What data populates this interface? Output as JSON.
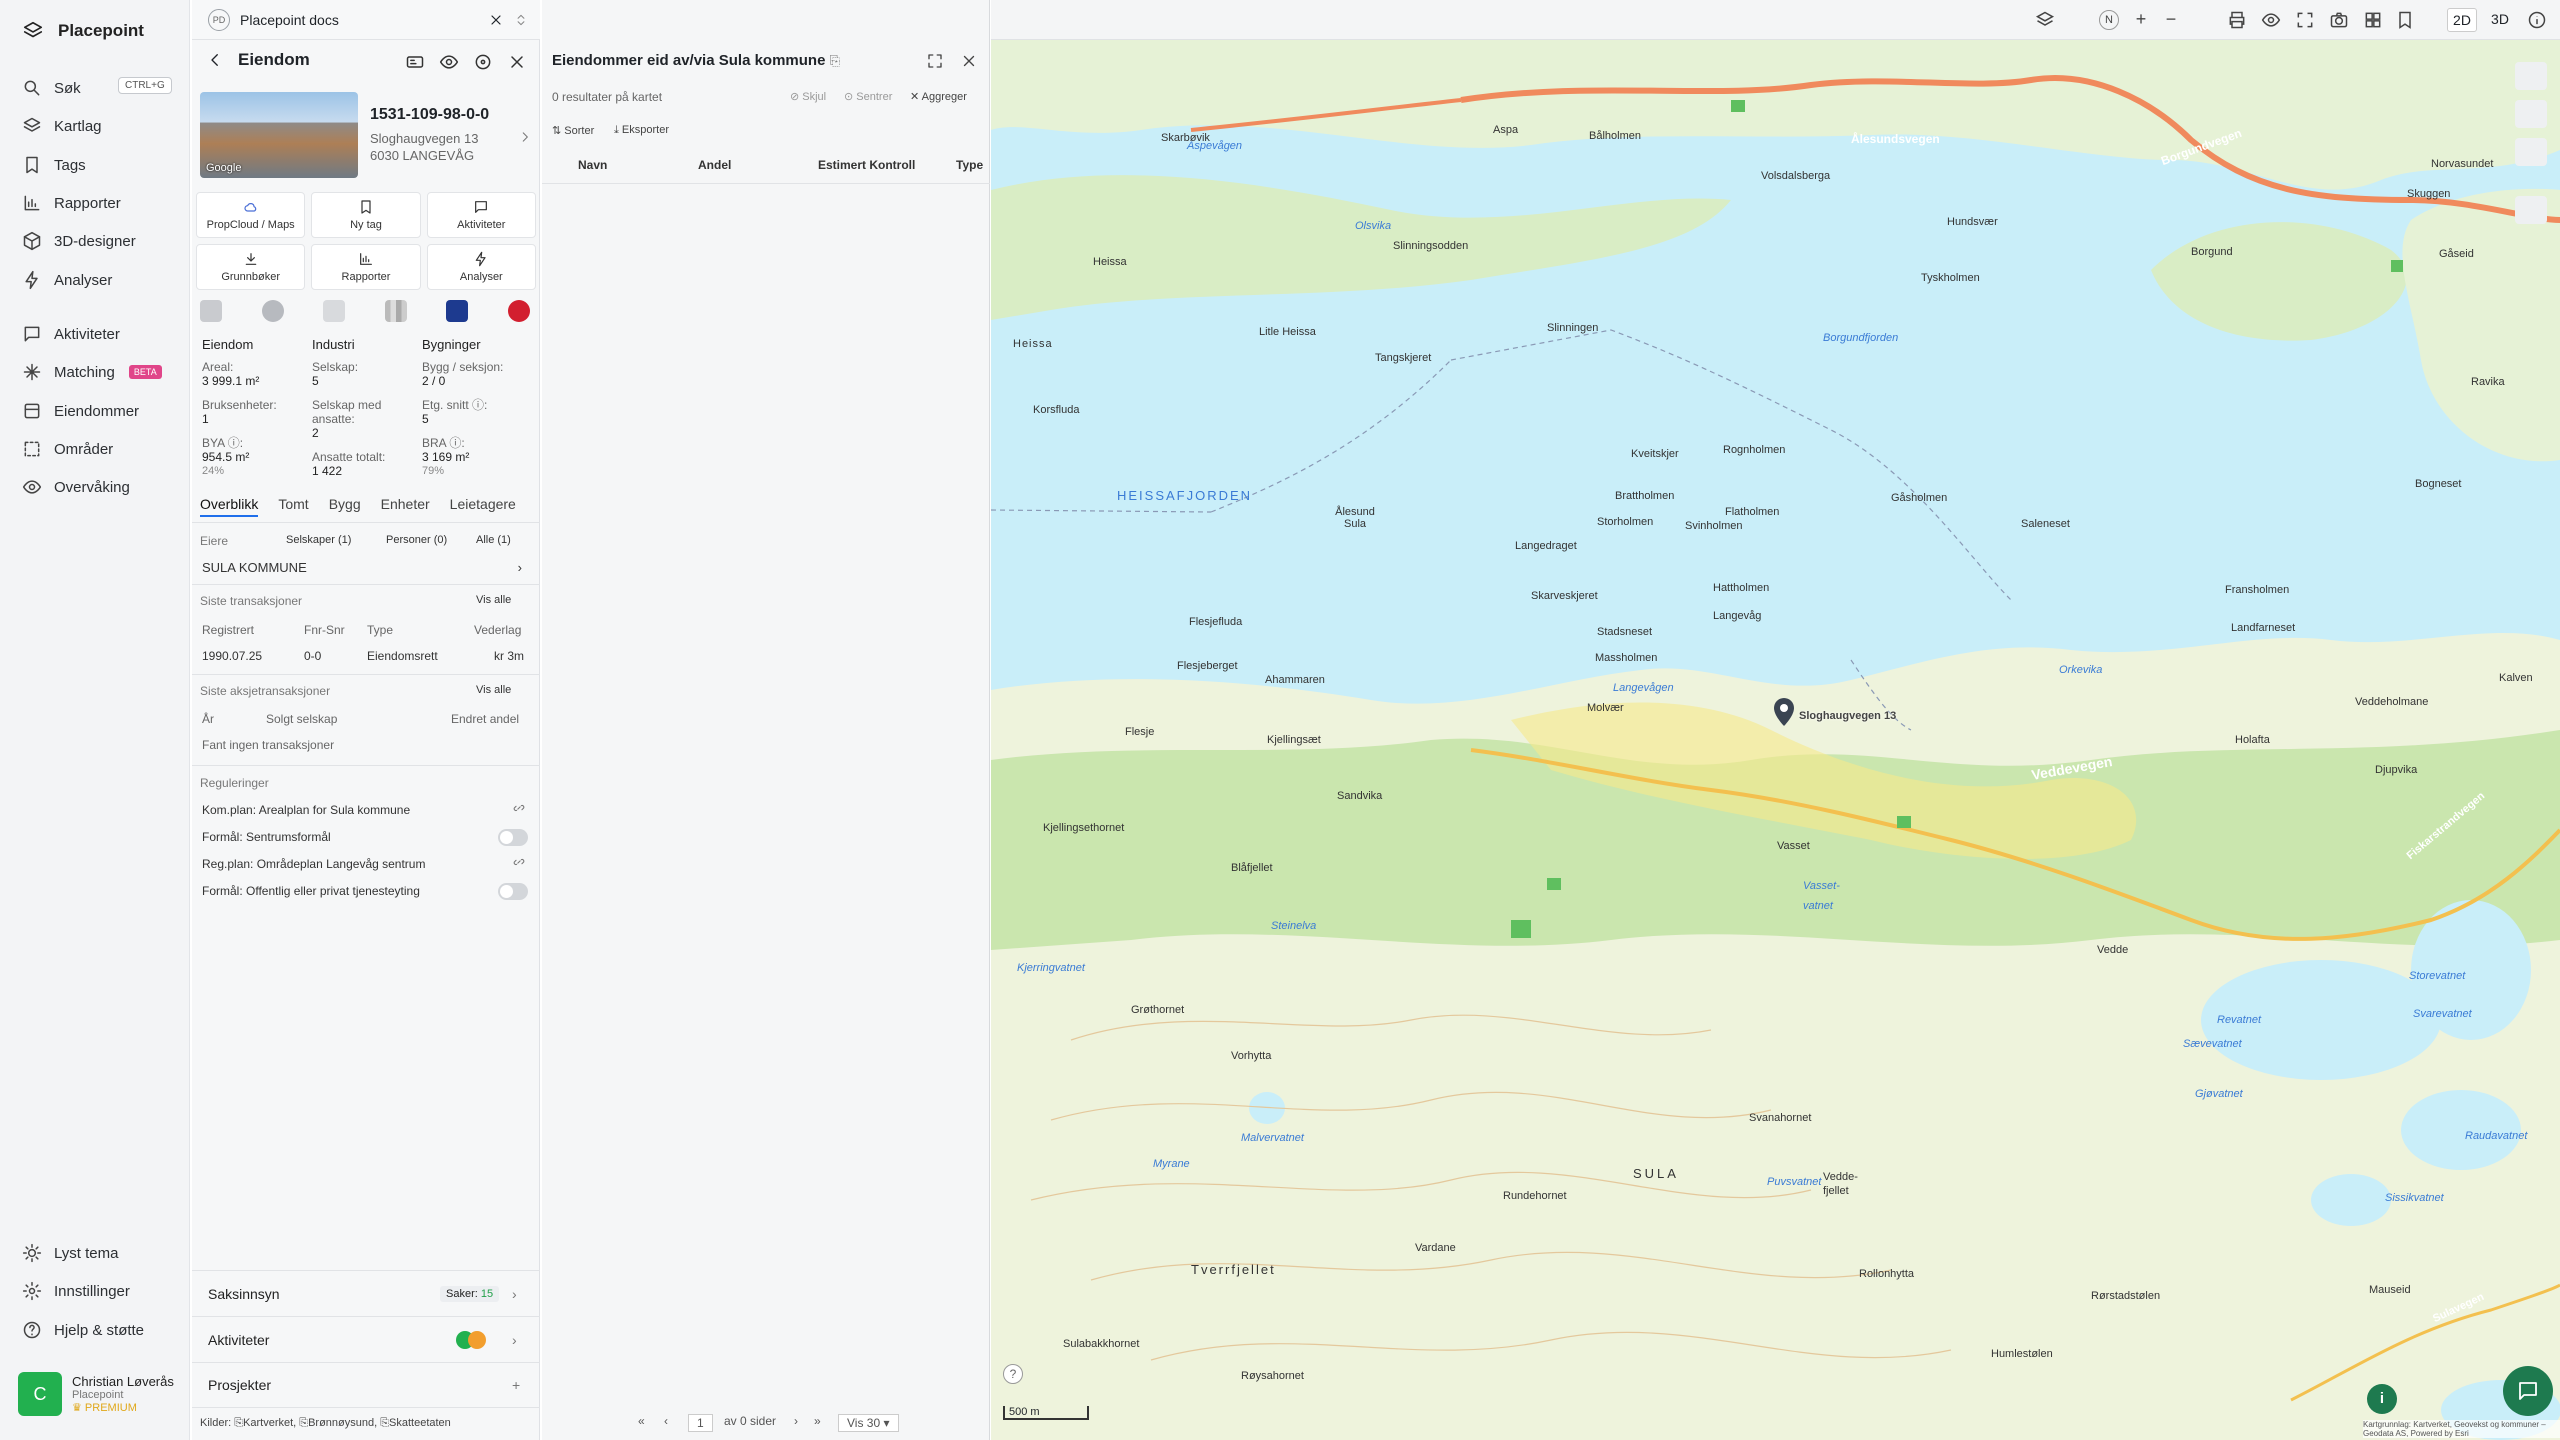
{
  "nav": {
    "brand": "Placepoint",
    "items": [
      {
        "label": "Søk",
        "icon": "search-icon"
      },
      {
        "label": "Kartlag",
        "icon": "layers-icon"
      },
      {
        "label": "Tags",
        "icon": "bookmark-icon"
      },
      {
        "label": "Rapporter",
        "icon": "chart-icon"
      },
      {
        "label": "3D-designer",
        "icon": "cube-icon"
      },
      {
        "label": "Analyser",
        "icon": "bolt-icon"
      },
      {
        "label": "Aktiviteter",
        "icon": "chat-icon"
      },
      {
        "label": "Matching",
        "icon": "sparkle-icon"
      },
      {
        "label": "Eiendommer",
        "icon": "building-icon"
      },
      {
        "label": "Områder",
        "icon": "area-icon"
      },
      {
        "label": "Overvåking",
        "icon": "eye-icon"
      }
    ],
    "search_shortcut": "CTRL+G",
    "matching_badge": "BETA",
    "bottom": [
      {
        "label": "Lyst tema",
        "icon": "sun-icon"
      },
      {
        "label": "Innstillinger",
        "icon": "gear-icon"
      },
      {
        "label": "Hjelp & støtte",
        "icon": "help-icon"
      }
    ],
    "user": {
      "initial": "C",
      "name": "Christian Løverås",
      "org": "Placepoint",
      "plan": "PREMIUM"
    }
  },
  "property": {
    "docs_tab": "Placepoint docs",
    "docs_badge": "PD",
    "header_title": "Eiendom",
    "id": "1531-109-98-0-0",
    "address_line1": "Sloghaugvegen 13",
    "address_line2": "6030 LANGEVÅG",
    "photo_credit": "Google",
    "tiles": [
      "PropCloud / Maps",
      "Ny tag",
      "Aktiviteter",
      "Grunnbøker",
      "Rapporter",
      "Analyser"
    ],
    "facts": {
      "col1": {
        "heading": "Eiendom",
        "areal_label": "Areal:",
        "areal_value": "3 999.1 m²",
        "bruk_label": "Bruksenheter:",
        "bruk_value": "1",
        "bya_label": "BYA ⓘ:",
        "bya_value": "954.5 m²",
        "bya_pct": "24%"
      },
      "col2": {
        "heading": "Industri",
        "selskap_label": "Selskap:",
        "selskap_value": "5",
        "ansatte_label": "Selskap med ansatte:",
        "ansatte_value": "2",
        "total_label": "Ansatte totalt:",
        "total_value": "1 422"
      },
      "col3": {
        "heading": "Bygninger",
        "bygg_label": "Bygg / seksjon:",
        "bygg_value": "2 / 0",
        "etg_label": "Etg. snitt ⓘ:",
        "etg_value": "5",
        "bra_label": "BRA ⓘ:",
        "bra_value": "3 169 m²",
        "bra_pct": "79%"
      }
    },
    "tabs": [
      "Overblikk",
      "Tomt",
      "Bygg",
      "Enheter",
      "Leietagere"
    ],
    "owners": {
      "label": "Eiere",
      "companies": "Selskaper (1)",
      "persons": "Personer (0)",
      "all": "Alle (1)",
      "name": "SULA KOMMUNE"
    },
    "transactions": {
      "label": "Siste transaksjoner",
      "view_all": "Vis alle",
      "headers": [
        "Registrert",
        "Fnr-Snr",
        "Type",
        "Vederlag"
      ],
      "row": [
        "1990.07.25",
        "0-0",
        "Eiendomsrett",
        "kr 3m"
      ]
    },
    "share_tx": {
      "label": "Siste aksjetransaksjoner",
      "view_all": "Vis alle",
      "headers": [
        "År",
        "Solgt selskap",
        "Endret andel"
      ],
      "empty": "Fant ingen transaksjoner"
    },
    "regulations": {
      "label": "Reguleringer",
      "items": [
        "Kom.plan: Arealplan for Sula kommune",
        "Formål: Sentrumsformål",
        "Reg.plan: Områdeplan Langevåg sentrum",
        "Formål: Offentlig eller privat tjenesteyting"
      ]
    },
    "accordions": {
      "saksinnsyn": "Saksinnsyn",
      "saker_label": "Saker:",
      "saker_count": "15",
      "aktiviteter": "Aktiviteter",
      "prosjekter": "Prosjekter"
    },
    "clients": "Kilder: ⎘Kartverket, ⎘Brønnøysund, ⎘Skatteetaten"
  },
  "results": {
    "title": "Eiendommer eid av/via Sula kommune",
    "subtitle": "0 resultater på kartet",
    "hide": "Skjul",
    "center": "Sentrer",
    "aggregate": "Aggreger",
    "sort": "Sorter",
    "export": "Eksporter",
    "columns": [
      "Navn",
      "Andel",
      "Estimert Kontroll",
      "Type"
    ],
    "pager": {
      "page": "1",
      "of_pages": "av 0 sider",
      "per_page": "Vis 30"
    }
  },
  "map": {
    "mode_2d": "2D",
    "mode_3d": "3D",
    "compass": "N",
    "scale": "500 m",
    "labels": [
      "Ålesundsvegen",
      "Borgundvegen",
      "Skarbøvik",
      "Aspa",
      "Bålholmen",
      "Aspevågen",
      "Volsdalsberga",
      "Norvasundet",
      "Skuggen",
      "Gåseid",
      "Olsvika",
      "Slinningsodden",
      "Hundsvær",
      "Borgund",
      "Heissa",
      "Tyskholmen",
      "Litle Heissa",
      "Tangskjeret",
      "Slinningen",
      "Heissa",
      "Borgundfjorden",
      "Korsfluda",
      "Kveitskjer",
      "Rognholmen",
      "Ravika",
      "HEISSAFJORDEN",
      "Brattholmen",
      "Gåsholmen",
      "Bogneset",
      "Ålesund Sula",
      "Storholmen",
      "Svinholmen",
      "Flatholmen",
      "Saleneset",
      "Langedraget",
      "Hattholmen",
      "Fransholmen",
      "Skarveskjeret",
      "Langevåg",
      "Landfarneset",
      "Flesjefluda",
      "Stadsneset",
      "Flesjeberget",
      "Massholmen",
      "Orkevika",
      "Langevågen",
      "Kalven",
      "Ahammaren",
      "Molvær",
      "Veddeholmane",
      "Flesje",
      "Kjellingsæt",
      "Holafta",
      "Veddevegen",
      "Djupvika",
      "Sandvika",
      "Fiskarstrandvegen",
      "Kjellingsethornet",
      "Vasset",
      "Blåfjellet",
      "Vasset-vatnet",
      "Steinelva",
      "Vedde",
      "Kjerringvatnet",
      "Storevatnet",
      "Grøthornet",
      "Vorhytta",
      "Revatnet",
      "Svarevatnet",
      "Sævevatnet",
      "Gjøvatnet",
      "Malvervatnet",
      "Svanahornet",
      "Raudavatnet",
      "Myrane",
      "SULA",
      "Puvsvatnet",
      "Vedde-fjellet",
      "Rundehornet",
      "Sissikvatnet",
      "Tverrfjellet",
      "Vardane",
      "Rollonhytta",
      "Rørstadstølen",
      "Mauseid",
      "Sulavegen",
      "Sulabakkhornet",
      "Røysahornet",
      "Humlestølen"
    ],
    "marker_label": "Sloghaugvegen 13",
    "attribution": "Kartgrunnlag: Kartverket, Geovekst og kommuner – Geodata AS, Powered by Esri"
  },
  "colors": {
    "accent": "#1f6feb",
    "land": "#e8f3d8",
    "forest": "#c2e3a4",
    "water": "#c9eef9",
    "road": "#f08a5d",
    "avatar": "#22b04f"
  }
}
